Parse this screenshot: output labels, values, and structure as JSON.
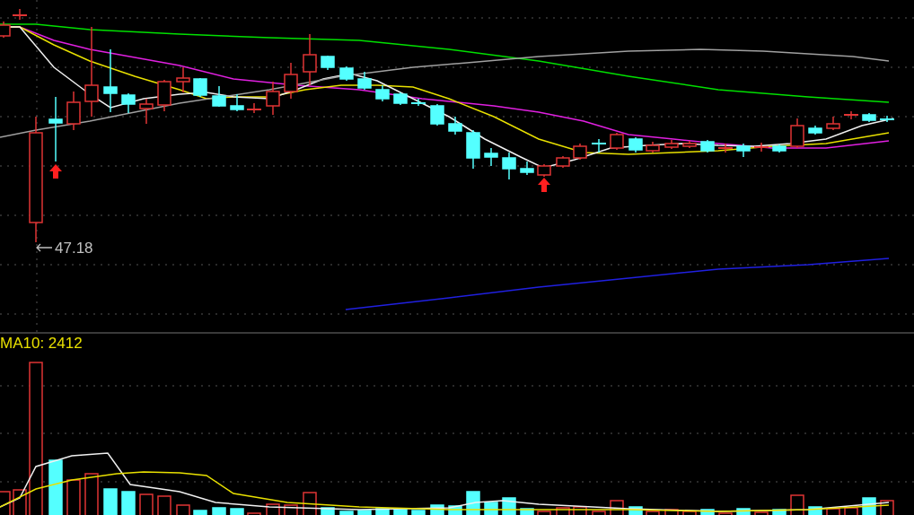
{
  "price_chart": {
    "low_marker": "47.18"
  },
  "volume_panel": {
    "indicator": "MA10: 2412"
  }
}
